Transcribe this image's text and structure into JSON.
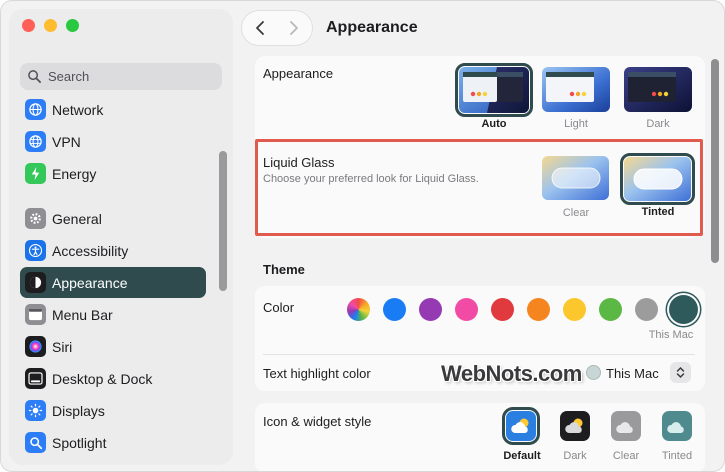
{
  "sidebar": {
    "search_placeholder": "Search",
    "items": [
      {
        "label": "Network",
        "icon": "globe-icon",
        "color": "#2d7df6",
        "active": false
      },
      {
        "label": "VPN",
        "icon": "vpn-globe-icon",
        "color": "#2d7df6",
        "active": false
      },
      {
        "label": "Energy",
        "icon": "bolt-icon",
        "color": "#34c759",
        "active": false
      },
      {
        "label": "General",
        "icon": "gear-icon",
        "color": "#8e8e93",
        "active": false
      },
      {
        "label": "Accessibility",
        "icon": "accessibility-icon",
        "color": "#1a73e8",
        "active": false
      },
      {
        "label": "Appearance",
        "icon": "appearance-icon",
        "color": "#1d1d1f",
        "active": true
      },
      {
        "label": "Menu Bar",
        "icon": "menu-bar-icon",
        "color": "#8e8e93",
        "active": false
      },
      {
        "label": "Siri",
        "icon": "siri-icon",
        "color": "#7a3ef0",
        "active": false
      },
      {
        "label": "Desktop & Dock",
        "icon": "dock-icon",
        "color": "#1d1d1f",
        "active": false
      },
      {
        "label": "Displays",
        "icon": "sun-icon",
        "color": "#2d7df6",
        "active": false
      },
      {
        "label": "Spotlight",
        "icon": "spotlight-icon",
        "color": "#2d7df6",
        "active": false
      }
    ]
  },
  "header": {
    "title": "Appearance"
  },
  "appearance": {
    "label": "Appearance",
    "options": [
      "Auto",
      "Light",
      "Dark"
    ],
    "selected": "Auto"
  },
  "liquid_glass": {
    "label": "Liquid Glass",
    "description": "Choose your preferred look for Liquid Glass.",
    "options": [
      "Clear",
      "Tinted"
    ],
    "selected": "Tinted"
  },
  "theme": {
    "title": "Theme",
    "color_label": "Color",
    "swatches": [
      "multicolor",
      "#1a7cf5",
      "#953ab3",
      "#f24ba5",
      "#e03a3e",
      "#f5861f",
      "#fcc72c",
      "#5cb844",
      "#9c9c9c",
      "#2f5a5c"
    ],
    "selected_swatch_label": "This Mac",
    "highlight_label": "Text highlight color",
    "highlight_value": "This Mac"
  },
  "icon_style": {
    "label": "Icon & widget style",
    "options": [
      "Default",
      "Dark",
      "Clear",
      "Tinted"
    ],
    "selected": "Default"
  },
  "watermark": "WebNots.com"
}
